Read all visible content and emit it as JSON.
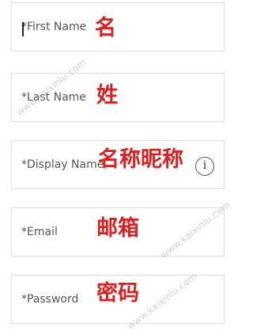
{
  "form": {
    "first_name": {
      "placeholder": "*First Name",
      "annotation": "名"
    },
    "last_name": {
      "placeholder": "*Last Name",
      "annotation": "姓"
    },
    "display_name": {
      "placeholder": "*Display Name",
      "annotation": "名称昵称",
      "info_icon_glyph": "i"
    },
    "email": {
      "placeholder": "*Email",
      "annotation": "邮箱"
    },
    "password": {
      "placeholder": "*Password",
      "annotation": "密码"
    }
  },
  "watermark": {
    "text_1": "www.kaixinlu.com",
    "text_2": "www.kaixinlu.com",
    "text_3": "www.kaixinlu.com"
  },
  "colors": {
    "annotation": "#e01e1e",
    "border": "#dcdcdc",
    "placeholder": "#555555"
  }
}
